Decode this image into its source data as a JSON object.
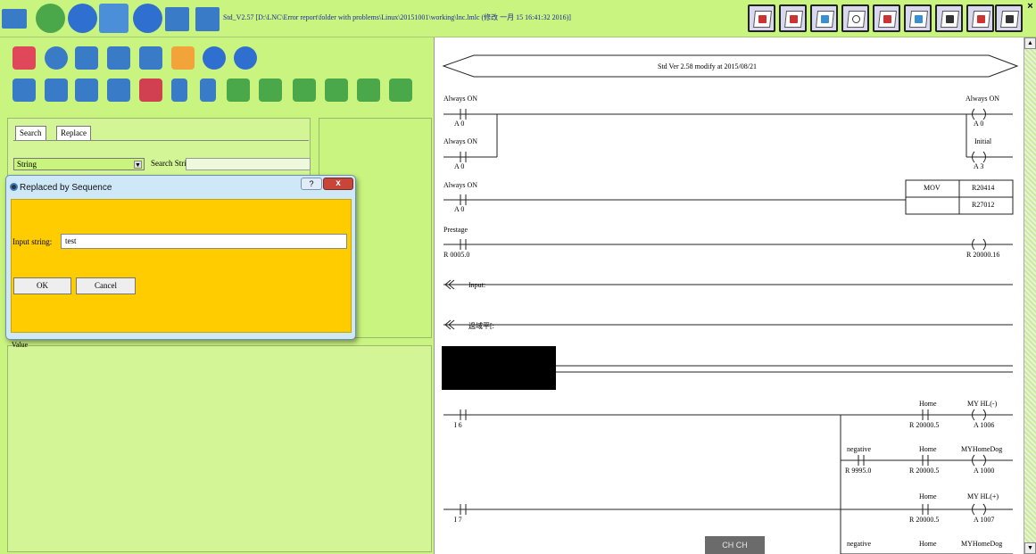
{
  "window": {
    "title": "Std_V2.57 [D:\\LNC\\Error report\\folder with problems\\Linux\\20151001\\working\\lnc.lmlc (修改 一月 15 16:41:32 2016)]",
    "close_label": "×"
  },
  "search_panel": {
    "tabs": [
      "Search",
      "Replace"
    ],
    "select_value": "String",
    "search_label": "Search String:",
    "bottom_label": "Value"
  },
  "dialog": {
    "title": "Replaced by Sequence",
    "help_label": "?",
    "close_label": "x",
    "input_label": "Input string:",
    "input_value": "test",
    "ok_label": "OK",
    "cancel_label": "Cancel"
  },
  "ladder": {
    "header": "Std Ver 2.58 modify at 2015/08/21",
    "rungs": {
      "r1_contact_label": "Always ON",
      "r1_contact_addr": "A 0",
      "r1_coil_label": "Always ON",
      "r1_coil_addr": "A 0",
      "r2_contact_label": "Always ON",
      "r2_contact_addr": "A 0",
      "r2_coil_label": "Initial",
      "r2_coil_addr": "A 3",
      "r3_contact_label": "Always ON",
      "r3_contact_addr": "A 0",
      "mov_label": "MOV",
      "mov_src": "R20414",
      "mov_dst": "R27012",
      "r4_contact_label": "Prestage",
      "r4_contact_addr": "R 0005.0",
      "r4_coil_addr": "R 20000.16",
      "comment1": "Input:",
      "comment2": "過域平[:",
      "r5_contact_addr": "I 6",
      "r5_home_label": "Home",
      "r5_home_addr": "R 20000.5",
      "r5_coil_label": "MY HL(-)",
      "r5_coil_addr": "A 1006",
      "r6_neg_label": "negative",
      "r6_neg_addr": "R 9995.0",
      "r6_home_label": "Home",
      "r6_home_addr": "R 20000.5",
      "r6_coil_label": "MYHomeDog",
      "r6_coil_addr": "A 1000",
      "r7_contact_addr": "I 7",
      "r7_home_label": "Home",
      "r7_home_addr": "R 20000.5",
      "r7_coil_label": "MY HL(+)",
      "r7_coil_addr": "A 1007",
      "r8_neg_label": "negative",
      "r8_home_label": "Home",
      "r8_coil_label": "MYHomeDog"
    }
  },
  "ime": {
    "label": "CH CH"
  },
  "icons": {
    "title_left": [
      "folder-icon",
      "globe-add-icon",
      "info-icon",
      "translate-icon",
      "lock-icon",
      "save-icon",
      "folder-remove-icon"
    ],
    "toolbar_row1": [
      "stack-add-icon",
      "cloud-icon",
      "document-icon",
      "list-icon",
      "eye-icon",
      "network-icon",
      "wrench-icon",
      "lock-icon"
    ],
    "toolbar_row2": [
      "document-add-icon",
      "copy-icon",
      "cut-icon",
      "delete-row-icon",
      "delete-icon",
      "undo-icon",
      "redo-icon",
      "insert-row-icon",
      "insert-line-icon",
      "insert-abc-icon",
      "insert-cmd-icon",
      "insert-rts-icon",
      "insert-end-icon"
    ],
    "title_right": [
      "book-a-icon",
      "book-b-icon",
      "book-c-icon",
      "book-d-icon",
      "book-e-icon",
      "book-f-icon",
      "book-g-icon",
      "book-h-icon",
      "book-i-icon"
    ]
  },
  "colors": {
    "panel_green": "#c9f47f",
    "dialog_yellow": "#ffcc00",
    "title_text": "#1a2a9a"
  }
}
